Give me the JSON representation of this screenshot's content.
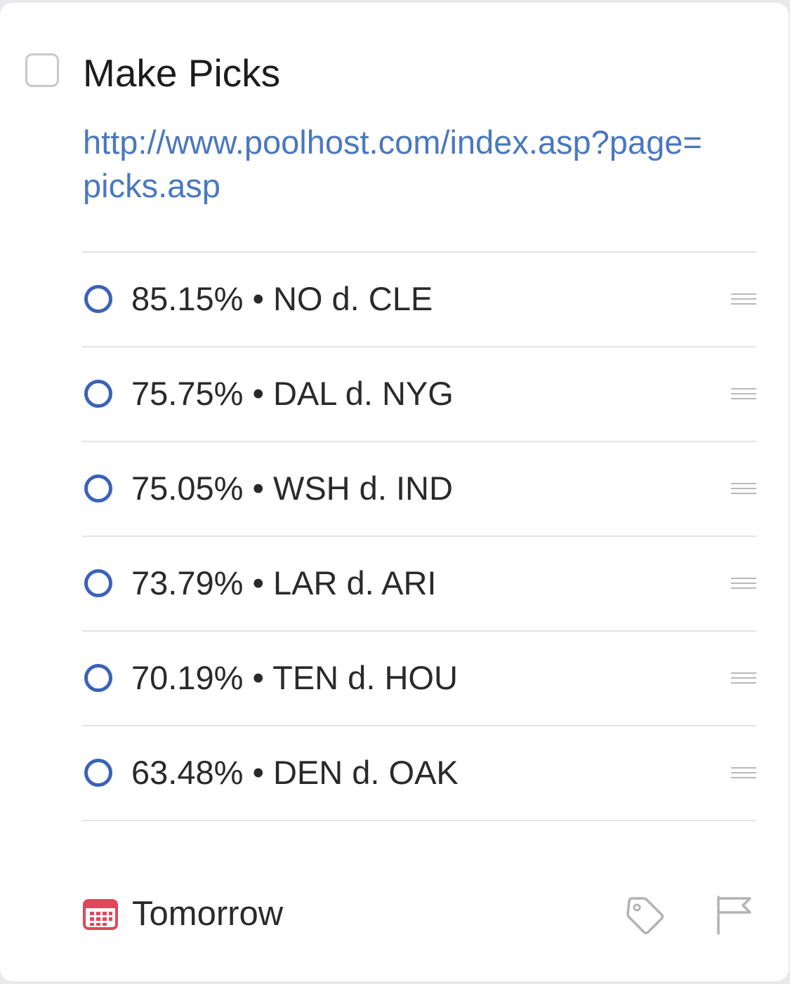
{
  "task": {
    "title": "Make Picks",
    "notes_link": "http://www.poolhost.com/index.asp?page=picks.asp"
  },
  "subtasks": [
    {
      "label": "85.15% • NO d. CLE"
    },
    {
      "label": "75.75% • DAL d. NYG"
    },
    {
      "label": "75.05% • WSH d. IND"
    },
    {
      "label": "73.79% • LAR d. ARI"
    },
    {
      "label": "70.19% • TEN d. HOU"
    },
    {
      "label": "63.48% • DEN d. OAK"
    }
  ],
  "footer": {
    "date_label": "Tomorrow",
    "date_icon": "calendar-icon",
    "tag_icon": "tag-icon",
    "flag_icon": "flag-icon"
  },
  "colors": {
    "link": "#4a78bf",
    "subtask_circle": "#3a62b8",
    "calendar": "#e0475a",
    "icon_gray": "#b3b3b7"
  }
}
